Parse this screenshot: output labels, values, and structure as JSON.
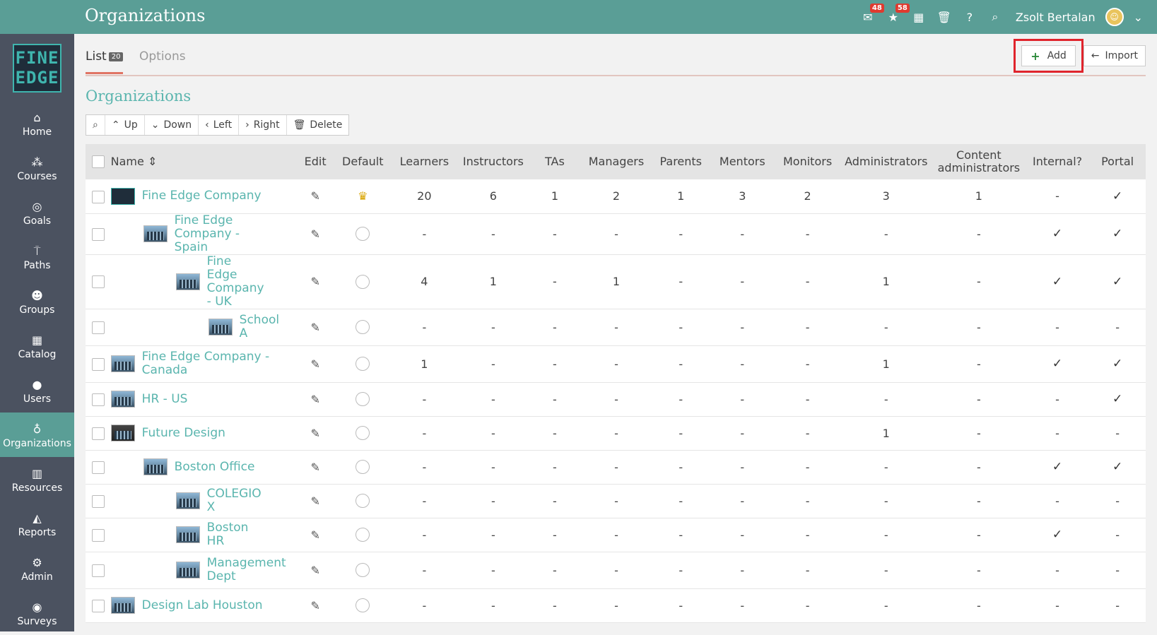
{
  "app": {
    "title": "Organizations",
    "logo": "FINE EDGE",
    "user": "Zsolt Bertalan"
  },
  "topbar": {
    "icons": [
      {
        "name": "messages-icon",
        "glyph": "✉",
        "badge": "48"
      },
      {
        "name": "notifications-icon",
        "glyph": "★",
        "badge": "58"
      },
      {
        "name": "calendar-icon",
        "glyph": "▦",
        "badge": ""
      },
      {
        "name": "trash-icon",
        "glyph": "🗑",
        "badge": ""
      },
      {
        "name": "help-icon",
        "glyph": "?",
        "badge": ""
      },
      {
        "name": "search-icon",
        "glyph": "⌕",
        "badge": ""
      }
    ]
  },
  "sidebar": {
    "items": [
      {
        "label": "Home",
        "icon": "home-icon",
        "glyph": "⌂",
        "active": false
      },
      {
        "label": "Courses",
        "icon": "courses-icon",
        "glyph": "⁂",
        "active": false
      },
      {
        "label": "Goals",
        "icon": "goals-icon",
        "glyph": "◎",
        "active": false
      },
      {
        "label": "Paths",
        "icon": "paths-icon",
        "glyph": "⍑",
        "active": false
      },
      {
        "label": "Groups",
        "icon": "groups-icon",
        "glyph": "☻",
        "active": false
      },
      {
        "label": "Catalog",
        "icon": "catalog-icon",
        "glyph": "▦",
        "active": false
      },
      {
        "label": "Users",
        "icon": "users-icon",
        "glyph": "●",
        "active": false
      },
      {
        "label": "Organizations",
        "icon": "organizations-icon",
        "glyph": "♁",
        "active": true
      },
      {
        "label": "Resources",
        "icon": "resources-icon",
        "glyph": "▥",
        "active": false
      },
      {
        "label": "Reports",
        "icon": "reports-icon",
        "glyph": "◭",
        "active": false
      },
      {
        "label": "Admin",
        "icon": "admin-icon",
        "glyph": "⚙",
        "active": false
      },
      {
        "label": "Surveys",
        "icon": "surveys-icon",
        "glyph": "◉",
        "active": false
      }
    ]
  },
  "tabs": {
    "list_label": "List",
    "list_count": "20",
    "options_label": "Options"
  },
  "actions": {
    "add_label": "Add",
    "import_label": "Import"
  },
  "section": {
    "title": "Organizations"
  },
  "toolbar": {
    "up": "Up",
    "down": "Down",
    "left": "Left",
    "right": "Right",
    "delete": "Delete"
  },
  "table": {
    "columns": [
      "Name",
      "Edit",
      "Default",
      "Learners",
      "Instructors",
      "TAs",
      "Managers",
      "Parents",
      "Mentors",
      "Monitors",
      "Administrators",
      "Content administrators",
      "Internal?",
      "Portal"
    ],
    "rows": [
      {
        "name": "Fine Edge Company",
        "level": 0,
        "thumb": "logo",
        "default": "crown",
        "learners": "20",
        "instructors": "6",
        "tas": "1",
        "managers": "2",
        "parents": "1",
        "mentors": "3",
        "monitors": "2",
        "administrators": "3",
        "content_admins": "1",
        "internal": "-",
        "portal": "✓"
      },
      {
        "name": "Fine Edge Company - Spain",
        "level": 1,
        "thumb": "building",
        "default": "radio",
        "learners": "-",
        "instructors": "-",
        "tas": "-",
        "managers": "-",
        "parents": "-",
        "mentors": "-",
        "monitors": "-",
        "administrators": "-",
        "content_admins": "-",
        "internal": "✓",
        "portal": "✓"
      },
      {
        "name": "Fine Edge Company - UK",
        "level": 2,
        "thumb": "building",
        "default": "radio",
        "learners": "4",
        "instructors": "1",
        "tas": "-",
        "managers": "1",
        "parents": "-",
        "mentors": "-",
        "monitors": "-",
        "administrators": "1",
        "content_admins": "-",
        "internal": "✓",
        "portal": "✓"
      },
      {
        "name": "School A",
        "level": 3,
        "thumb": "building",
        "default": "radio",
        "learners": "-",
        "instructors": "-",
        "tas": "-",
        "managers": "-",
        "parents": "-",
        "mentors": "-",
        "monitors": "-",
        "administrators": "-",
        "content_admins": "-",
        "internal": "-",
        "portal": "-"
      },
      {
        "name": "Fine Edge Company - Canada",
        "level": 0,
        "thumb": "building",
        "default": "radio",
        "learners": "1",
        "instructors": "-",
        "tas": "-",
        "managers": "-",
        "parents": "-",
        "mentors": "-",
        "monitors": "-",
        "administrators": "1",
        "content_admins": "-",
        "internal": "✓",
        "portal": "✓"
      },
      {
        "name": "HR - US",
        "level": 0,
        "thumb": "building",
        "default": "radio",
        "learners": "-",
        "instructors": "-",
        "tas": "-",
        "managers": "-",
        "parents": "-",
        "mentors": "-",
        "monitors": "-",
        "administrators": "-",
        "content_admins": "-",
        "internal": "-",
        "portal": "✓"
      },
      {
        "name": "Future Design",
        "level": 0,
        "thumb": "dark",
        "default": "radio",
        "learners": "-",
        "instructors": "-",
        "tas": "-",
        "managers": "-",
        "parents": "-",
        "mentors": "-",
        "monitors": "-",
        "administrators": "1",
        "content_admins": "-",
        "internal": "-",
        "portal": "-"
      },
      {
        "name": "Boston Office",
        "level": 1,
        "thumb": "building",
        "default": "radio",
        "learners": "-",
        "instructors": "-",
        "tas": "-",
        "managers": "-",
        "parents": "-",
        "mentors": "-",
        "monitors": "-",
        "administrators": "-",
        "content_admins": "-",
        "internal": "✓",
        "portal": "✓"
      },
      {
        "name": "COLEGIO X",
        "level": 2,
        "thumb": "building",
        "default": "radio",
        "learners": "-",
        "instructors": "-",
        "tas": "-",
        "managers": "-",
        "parents": "-",
        "mentors": "-",
        "monitors": "-",
        "administrators": "-",
        "content_admins": "-",
        "internal": "-",
        "portal": "-"
      },
      {
        "name": "Boston HR",
        "level": 2,
        "thumb": "building",
        "default": "radio",
        "learners": "-",
        "instructors": "-",
        "tas": "-",
        "managers": "-",
        "parents": "-",
        "mentors": "-",
        "monitors": "-",
        "administrators": "-",
        "content_admins": "-",
        "internal": "✓",
        "portal": "-"
      },
      {
        "name": "Management Dept",
        "level": 2,
        "thumb": "building",
        "default": "radio",
        "learners": "-",
        "instructors": "-",
        "tas": "-",
        "managers": "-",
        "parents": "-",
        "mentors": "-",
        "monitors": "-",
        "administrators": "-",
        "content_admins": "-",
        "internal": "-",
        "portal": "-"
      },
      {
        "name": "Design Lab Houston",
        "level": 0,
        "thumb": "building",
        "default": "radio",
        "learners": "-",
        "instructors": "-",
        "tas": "-",
        "managers": "-",
        "parents": "-",
        "mentors": "-",
        "monitors": "-",
        "administrators": "-",
        "content_admins": "-",
        "internal": "-",
        "portal": "-"
      }
    ]
  }
}
